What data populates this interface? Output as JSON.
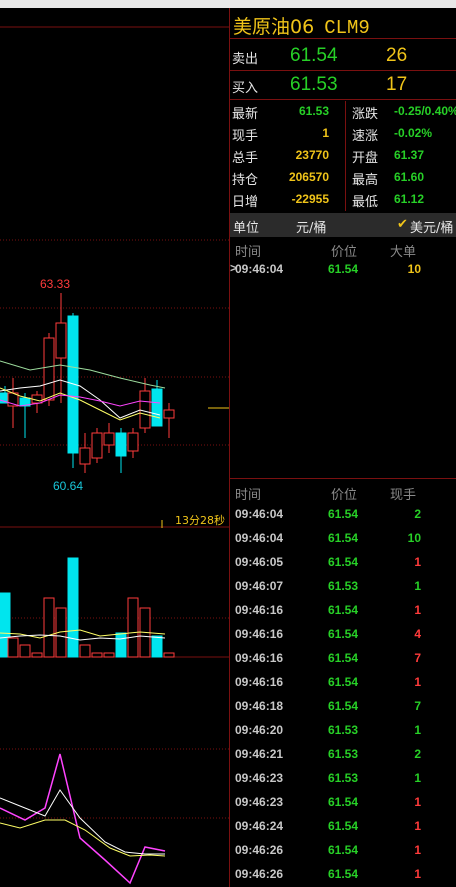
{
  "instrument": {
    "name": "美原油06",
    "code": "CLM9"
  },
  "quote": {
    "sell_label": "卖出",
    "sell_price": "61.54",
    "sell_qty": "26",
    "buy_label": "买入",
    "buy_price": "61.53",
    "buy_qty": "17"
  },
  "stats": [
    {
      "label": "最新",
      "value": "61.53",
      "color": "#27d027",
      "label2": "涨跌",
      "value2": "-0.25/0.40%",
      "color2": "#27d027"
    },
    {
      "label": "现手",
      "value": "1",
      "color": "#f0c419",
      "label2": "速涨",
      "value2": "-0.02%",
      "color2": "#27d027"
    },
    {
      "label": "总手",
      "value": "23770",
      "color": "#f0c419",
      "label2": "开盘",
      "value2": "61.37",
      "color2": "#27d027"
    },
    {
      "label": "持仓",
      "value": "206570",
      "color": "#f0c419",
      "label2": "最高",
      "value2": "61.60",
      "color2": "#27d027"
    },
    {
      "label": "日增",
      "value": "-22955",
      "color": "#f0c419",
      "label2": "最低",
      "value2": "61.12",
      "color2": "#27d027"
    }
  ],
  "unit": {
    "label": "单位",
    "option1": "元/桶",
    "option2": "美元/桶",
    "check": "✔"
  },
  "big_trades": {
    "headers": [
      "时间",
      "价位",
      "大单"
    ],
    "rows": [
      {
        "time": "09:46:04",
        "price": "61.54",
        "qty": "10"
      }
    ]
  },
  "ticks": {
    "headers": [
      "时间",
      "价位",
      "现手"
    ],
    "rows": [
      {
        "time": "09:46:04",
        "price": "61.54",
        "qty": "2",
        "color": "#27d027"
      },
      {
        "time": "09:46:04",
        "price": "61.54",
        "qty": "10",
        "color": "#27d027"
      },
      {
        "time": "09:46:05",
        "price": "61.54",
        "qty": "1",
        "color": "#ff3b3b"
      },
      {
        "time": "09:46:07",
        "price": "61.53",
        "qty": "1",
        "color": "#27d027"
      },
      {
        "time": "09:46:16",
        "price": "61.54",
        "qty": "1",
        "color": "#ff3b3b"
      },
      {
        "time": "09:46:16",
        "price": "61.54",
        "qty": "4",
        "color": "#ff3b3b"
      },
      {
        "time": "09:46:16",
        "price": "61.54",
        "qty": "7",
        "color": "#ff3b3b"
      },
      {
        "time": "09:46:16",
        "price": "61.54",
        "qty": "1",
        "color": "#ff3b3b"
      },
      {
        "time": "09:46:18",
        "price": "61.54",
        "qty": "7",
        "color": "#27d027"
      },
      {
        "time": "09:46:20",
        "price": "61.53",
        "qty": "1",
        "color": "#27d027"
      },
      {
        "time": "09:46:21",
        "price": "61.53",
        "qty": "2",
        "color": "#27d027"
      },
      {
        "time": "09:46:23",
        "price": "61.53",
        "qty": "1",
        "color": "#27d027"
      },
      {
        "time": "09:46:23",
        "price": "61.54",
        "qty": "1",
        "color": "#ff3b3b"
      },
      {
        "time": "09:46:24",
        "price": "61.54",
        "qty": "1",
        "color": "#ff3b3b"
      },
      {
        "time": "09:46:26",
        "price": "61.54",
        "qty": "1",
        "color": "#ff3b3b"
      },
      {
        "time": "09:46:26",
        "price": "61.54",
        "qty": "1",
        "color": "#ff3b3b"
      }
    ]
  },
  "chart_data": {
    "type": "candlestick",
    "max_label": "63.33",
    "min_label": "60.64",
    "countdown": "13分28秒",
    "colors": {
      "up": "#ff3b3b",
      "down": "#00e5ee",
      "grid": "#7a1010",
      "ma1": "#ffffff",
      "ma2": "#ffff66",
      "ma3": "#ff44ff",
      "ma4": "#9ddc9d"
    }
  }
}
